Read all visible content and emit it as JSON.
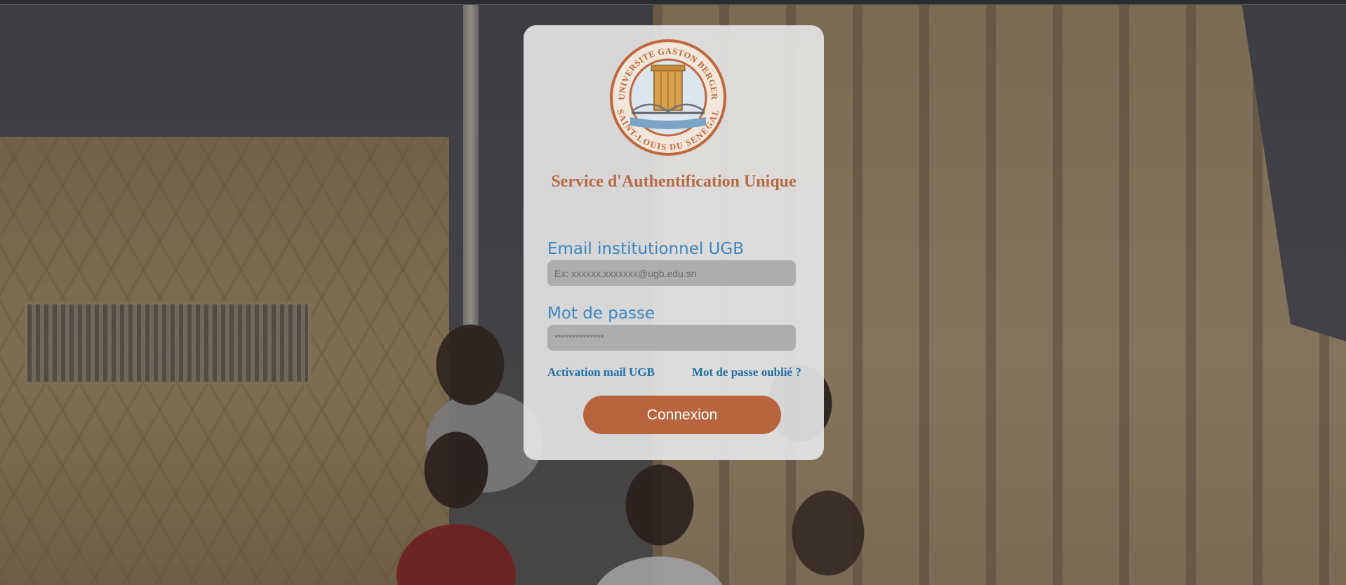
{
  "logo": {
    "ring_top": "UNIVERSITE GASTON BERGER",
    "ring_bottom": "SAINT-LOUIS DU SENEGAL",
    "color": "#c0663d"
  },
  "login": {
    "title": "Service d'Authentification Unique",
    "email_label": "Email institutionnel UGB",
    "email_placeholder": "Ex: xxxxxx.xxxxxxx@ugb.edu.sn",
    "email_value": "",
    "password_label": "Mot de passe",
    "password_placeholder": "**************",
    "password_value": "",
    "activation_link": "Activation mail UGB",
    "forgot_link": "Mot de passe oublié ?",
    "submit_label": "Connexion"
  },
  "colors": {
    "accent": "#b8653f",
    "title": "#b86a44",
    "label": "#3b86c0",
    "link": "#1e6fa6",
    "input_bg": "#adadad"
  }
}
